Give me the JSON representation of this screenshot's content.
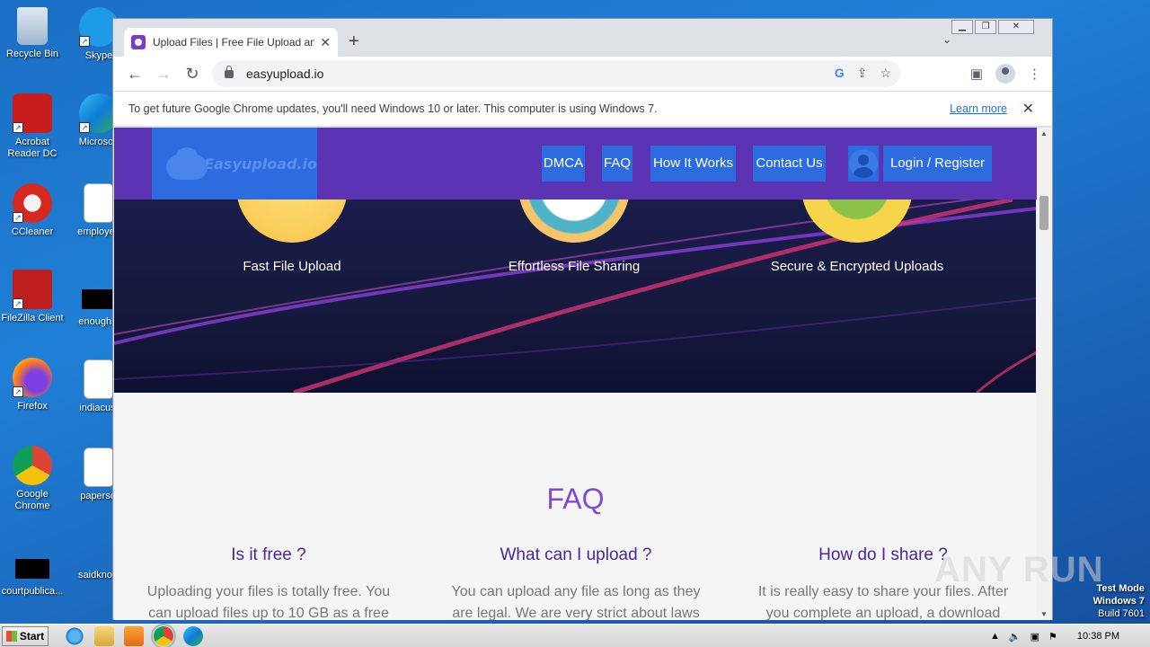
{
  "desktop": {
    "icons_left": [
      {
        "label": "Recycle Bin"
      },
      {
        "label": "Acrobat Reader DC"
      },
      {
        "label": "CCleaner"
      },
      {
        "label": "FileZilla Client"
      },
      {
        "label": "Firefox"
      },
      {
        "label": "Google Chrome"
      },
      {
        "label": "courtpublica..."
      }
    ],
    "icons_right": [
      {
        "label": "Skype"
      },
      {
        "label": "Microsoft"
      },
      {
        "label": "employee"
      },
      {
        "label": "enoughst"
      },
      {
        "label": "indiacust"
      },
      {
        "label": "paperscl"
      },
      {
        "label": "saidknow"
      }
    ],
    "watermark": "ANY RUN",
    "test_mode": {
      "line1": "Test Mode",
      "line2": "Windows 7",
      "line3": "Build 7601"
    }
  },
  "browser": {
    "tab_title": "Upload Files | Free File Upload and T",
    "tab_close": "✕",
    "new_tab": "+",
    "tab_menu": "⌄",
    "url": "easyupload.io",
    "back": "←",
    "forward": "→",
    "reload": "↻",
    "infobar_text": "To get future Google Chrome updates, you'll need Windows 10 or later. This computer is using Windows 7.",
    "infobar_link": "Learn more",
    "infobar_close": "✕"
  },
  "site": {
    "logo_text": "Easyupload.io",
    "menu": {
      "dmca": "DMCA",
      "faq": "FAQ",
      "how": "How It Works",
      "contact": "Contact Us",
      "login": "Login / Register"
    },
    "features": [
      "Fast File Upload",
      "Effortless File Sharing",
      "Secure & Encrypted Uploads"
    ],
    "faq_title": "FAQ",
    "faq": [
      {
        "q": "Is it free ?",
        "a": "Uploading your files is totally free. You can upload files up to 10 GB as a free"
      },
      {
        "q": "What can I upload ?",
        "a": "You can upload any file as long as they are legal. We are very strict about laws"
      },
      {
        "q": "How do I share ?",
        "a": "It is really easy to share your files. After you complete an upload, a download"
      }
    ]
  },
  "taskbar": {
    "start": "Start",
    "clock": "10:38 PM"
  },
  "colors": {
    "header": "#5c34b3",
    "menu_button": "#2d6cdf",
    "faq_title": "#7f4ad1",
    "faq_question": "#46289a"
  }
}
